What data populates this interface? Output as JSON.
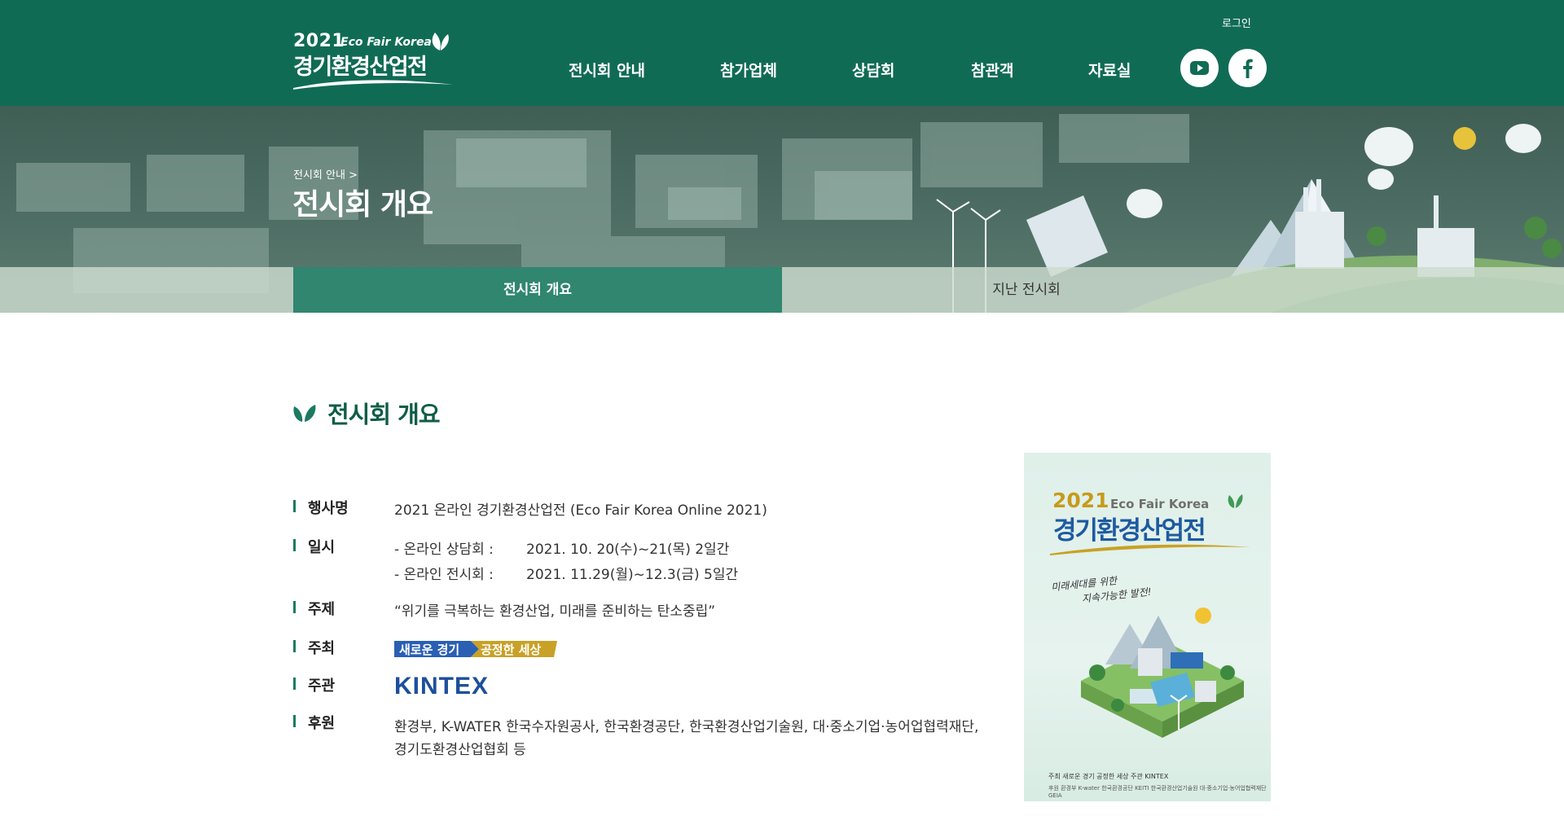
{
  "header": {
    "logo": {
      "year": "2021",
      "en": "Eco Fair Korea",
      "ko": "경기환경산업전"
    },
    "login": "로그인",
    "nav": [
      "전시회 안내",
      "참가업체",
      "상담회",
      "참관객",
      "자료실"
    ],
    "social": [
      "youtube-icon",
      "facebook-icon"
    ]
  },
  "banner": {
    "breadcrumb": "전시회 안내 >",
    "title": "전시회 개요",
    "tabs": [
      {
        "label": "전시회 개요",
        "active": true
      },
      {
        "label": "지난 전시회",
        "active": false
      }
    ]
  },
  "content": {
    "section_title": "전시회 개요",
    "rows": {
      "event_name": {
        "label": "행사명",
        "value": "2021 온라인 경기환경산업전 (Eco Fair Korea Online 2021)"
      },
      "schedule": {
        "label": "일시",
        "items": [
          {
            "name": "-  온라인 상담회 :",
            "date": "2021. 10. 20(수)~21(목) 2일간"
          },
          {
            "name": "-  온라인 전시회 :",
            "date": "2021. 11.29(월)~12.3(금) 5일간"
          }
        ]
      },
      "theme": {
        "label": "주제",
        "value": "“위기를 극복하는 환경산업, 미래를 준비하는 탄소중립”"
      },
      "host": {
        "label": "주최",
        "badge_left": "새로운 경기",
        "badge_right": "공정한 세상"
      },
      "organizer": {
        "label": "주관",
        "value": "KINTEX"
      },
      "sponsor": {
        "label": "후원",
        "line1": "환경부, K-WATER 한국수자원공사, 한국환경공단, 한국환경산업기술원, 대·중소기업·농어업협력재단,",
        "line2": "경기도환경산업협회 등"
      }
    }
  },
  "poster": {
    "year": "2021",
    "en": "Eco Fair Korea",
    "ko": "경기환경산업전",
    "tagline1": "미래세대를 위한",
    "tagline2": "지속가능한 발전!",
    "footer1": "주최 새로운 경기 공정한 세상   주관 KINTEX",
    "footer2": "후원 환경부 K-water 한국환경공단 KEITI 한국환경산업기술원 대·중소기업·농어업협력재단 GEIA"
  },
  "colors": {
    "header_bg": "#106b55",
    "active_tab": "#30866f",
    "title_green": "#0f5d48",
    "kintex_blue": "#1c4f9c"
  }
}
